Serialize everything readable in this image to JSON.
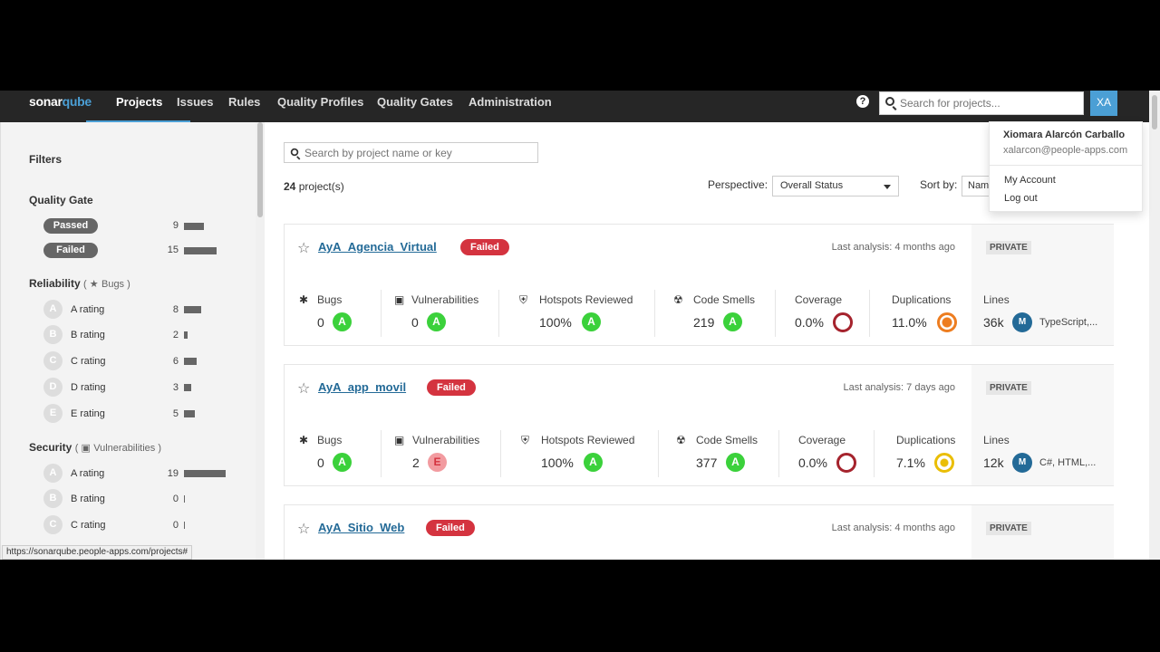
{
  "nav": {
    "logo_a": "sonar",
    "logo_b": "qube",
    "items": [
      "Projects",
      "Issues",
      "Rules",
      "Quality Profiles",
      "Quality Gates",
      "Administration"
    ],
    "help": "?",
    "search_placeholder": "Search for projects...",
    "avatar": "XA"
  },
  "account": {
    "name": "Xiomara Alarcón Carballo",
    "email": "xalarcon@people-apps.com",
    "my_account": "My Account",
    "logout": "Log out"
  },
  "filters": {
    "title": "Filters",
    "quality_gate": {
      "title": "Quality Gate",
      "items": [
        {
          "label": "Passed",
          "count": "9"
        },
        {
          "label": "Failed",
          "count": "15"
        }
      ]
    },
    "reliability": {
      "title": "Reliability",
      "sub": "Bugs",
      "items": [
        {
          "letter": "A",
          "label": "A rating",
          "count": "8"
        },
        {
          "letter": "B",
          "label": "B rating",
          "count": "2"
        },
        {
          "letter": "C",
          "label": "C rating",
          "count": "6"
        },
        {
          "letter": "D",
          "label": "D rating",
          "count": "3"
        },
        {
          "letter": "E",
          "label": "E rating",
          "count": "5"
        }
      ]
    },
    "security": {
      "title": "Security",
      "sub": "Vulnerabilities",
      "items": [
        {
          "letter": "A",
          "label": "A rating",
          "count": "19"
        },
        {
          "letter": "B",
          "label": "B rating",
          "count": "0"
        },
        {
          "letter": "C",
          "label": "C rating",
          "count": "0"
        }
      ]
    }
  },
  "main": {
    "search_placeholder": "Search by project name or key",
    "count_num": "24",
    "count_text": "project(s)",
    "perspective_label": "Perspective:",
    "perspective_value": "Overall Status",
    "sort_label": "Sort by:",
    "sort_value": "Nam"
  },
  "projects": [
    {
      "name": "AyA_Agencia_Virtual",
      "status": "Failed",
      "last": "Last analysis: 4 months ago",
      "visibility": "PRIVATE",
      "bugs": "0",
      "bugs_rating": "A",
      "vulns": "0",
      "vulns_rating": "A",
      "hotspots": "100%",
      "hotspots_rating": "A",
      "smells": "219",
      "smells_rating": "A",
      "coverage": "0.0%",
      "dup": "11.0%",
      "lines": "36k",
      "lang_badge": "M",
      "langs": "TypeScript,..."
    },
    {
      "name": "AyA_app_movil",
      "status": "Failed",
      "last": "Last analysis: 7 days ago",
      "visibility": "PRIVATE",
      "bugs": "0",
      "bugs_rating": "A",
      "vulns": "2",
      "vulns_rating": "E",
      "hotspots": "100%",
      "hotspots_rating": "A",
      "smells": "377",
      "smells_rating": "A",
      "coverage": "0.0%",
      "dup": "7.1%",
      "lines": "12k",
      "lang_badge": "M",
      "langs": "C#, HTML,..."
    },
    {
      "name": "AyA_Sitio_Web",
      "status": "Failed",
      "last": "Last analysis: 4 months ago",
      "visibility": "PRIVATE"
    }
  ],
  "metric_labels": {
    "bugs": "Bugs",
    "vulns": "Vulnerabilities",
    "hotspots": "Hotspots Reviewed",
    "smells": "Code Smells",
    "coverage": "Coverage",
    "dup": "Duplications",
    "lines": "Lines"
  },
  "status_url": "https://sonarqube.people-apps.com/projects#",
  "colors": {
    "rating_a": "#3bd13b",
    "rating_e": "#f29ba0",
    "failed": "#d4333f",
    "link": "#236a97",
    "nav": "#262626",
    "accent": "#4b9fd5"
  }
}
